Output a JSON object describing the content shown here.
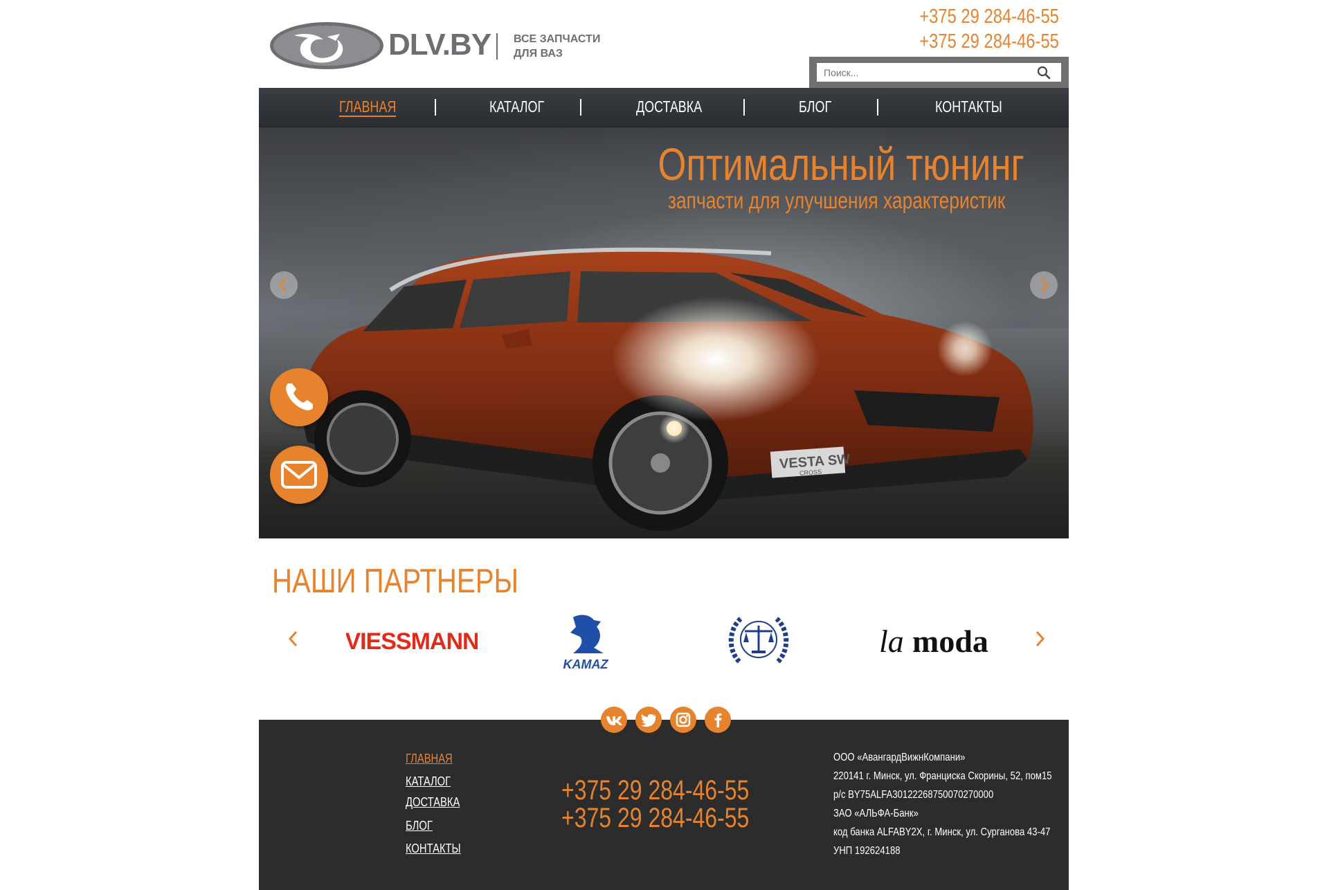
{
  "header": {
    "logo_text": "DLV.BY",
    "tagline_line1": "ВСЕ ЗАПЧАСТИ",
    "tagline_line2": "ДЛЯ ВАЗ",
    "phones": [
      "+375 29 284-46-55",
      "+375 29 284-46-55"
    ],
    "search_placeholder": "Поиск..."
  },
  "nav": {
    "items": [
      {
        "label": "ГЛАВНАЯ",
        "active": true
      },
      {
        "label": "КАТАЛОГ",
        "active": false
      },
      {
        "label": "ДОСТАВКА",
        "active": false
      },
      {
        "label": "БЛОГ",
        "active": false
      },
      {
        "label": "КОНТАКТЫ",
        "active": false
      }
    ]
  },
  "hero": {
    "title": "Оптимальный тюнинг",
    "subtitle": "запчасти для улучшения характеристик",
    "plate_text": "VESTA SW",
    "plate_sub": "CROSS"
  },
  "partners": {
    "title": "НАШИ ПАРТНЕРЫ",
    "logos": {
      "viessmann": "VIESSMANN",
      "kamaz": "KAMAZ",
      "lamoda_italic": "la",
      "lamoda_bold": "moda"
    }
  },
  "footer": {
    "links": [
      "ГЛАВНАЯ",
      "КАТАЛОГ",
      "ДОСТАВКА",
      "БЛОГ",
      "КОНТАКТЫ"
    ],
    "phones": [
      "+375 29 284-46-55",
      "+375 29 284-46-55"
    ],
    "company_info": [
      "ООО «АвангардВижнКомпани»",
      "220141 г. Минск, ул. Франциска Скорины, 52, пом15",
      "р/с BY75ALFA30122268750070270000",
      "ЗАО «АЛЬФА-Банк»",
      "код банка ALFABY2X, г. Минск, ул. Сурганова 43-47",
      "УНП 192624188"
    ]
  },
  "colors": {
    "accent": "#e8832d",
    "nav_bg": "#2f3337",
    "footer_bg": "#2c2c2c",
    "logo_gray": "#6d6e72"
  },
  "icons": {
    "search": "search-icon",
    "prev": "chevron-left-icon",
    "next": "chevron-right-icon",
    "call": "phone-icon",
    "mail": "envelope-icon",
    "social": [
      "vk-icon",
      "twitter-icon",
      "instagram-icon",
      "facebook-icon"
    ]
  }
}
